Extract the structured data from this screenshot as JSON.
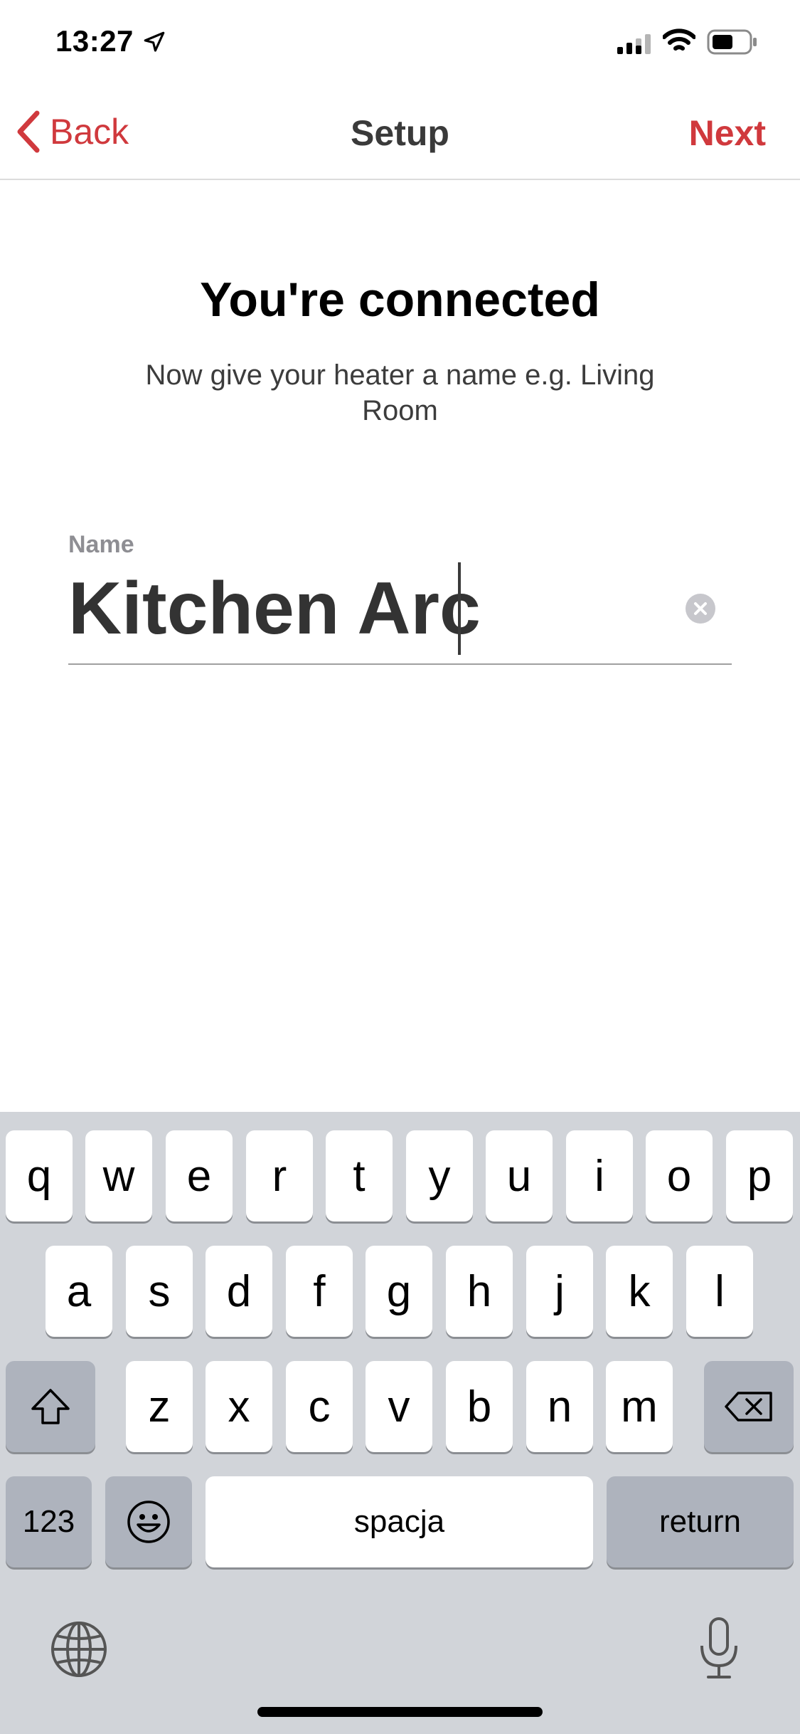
{
  "status_bar": {
    "time": "13:27"
  },
  "nav": {
    "back_label": "Back",
    "title": "Setup",
    "next_label": "Next"
  },
  "content": {
    "heading": "You're connected",
    "subtitle": "Now give your heater a name e.g. Living Room",
    "name_label": "Name",
    "name_value": "Kitchen Arc"
  },
  "keyboard": {
    "row1": [
      "q",
      "w",
      "e",
      "r",
      "t",
      "y",
      "u",
      "i",
      "o",
      "p"
    ],
    "row2": [
      "a",
      "s",
      "d",
      "f",
      "g",
      "h",
      "j",
      "k",
      "l"
    ],
    "row3": [
      "z",
      "x",
      "c",
      "v",
      "b",
      "n",
      "m"
    ],
    "numbers_label": "123",
    "space_label": "spacja",
    "return_label": "return"
  },
  "colors": {
    "accent": "#d0393d",
    "keyboard_bg": "#d1d4d9",
    "function_key": "#aeb3bd"
  },
  "icons": [
    "location-arrow-icon",
    "cellular-signal-icon",
    "wifi-icon",
    "battery-icon",
    "chevron-left-icon",
    "clear-text-icon",
    "shift-icon",
    "backspace-icon",
    "emoji-icon",
    "globe-icon",
    "microphone-icon"
  ]
}
